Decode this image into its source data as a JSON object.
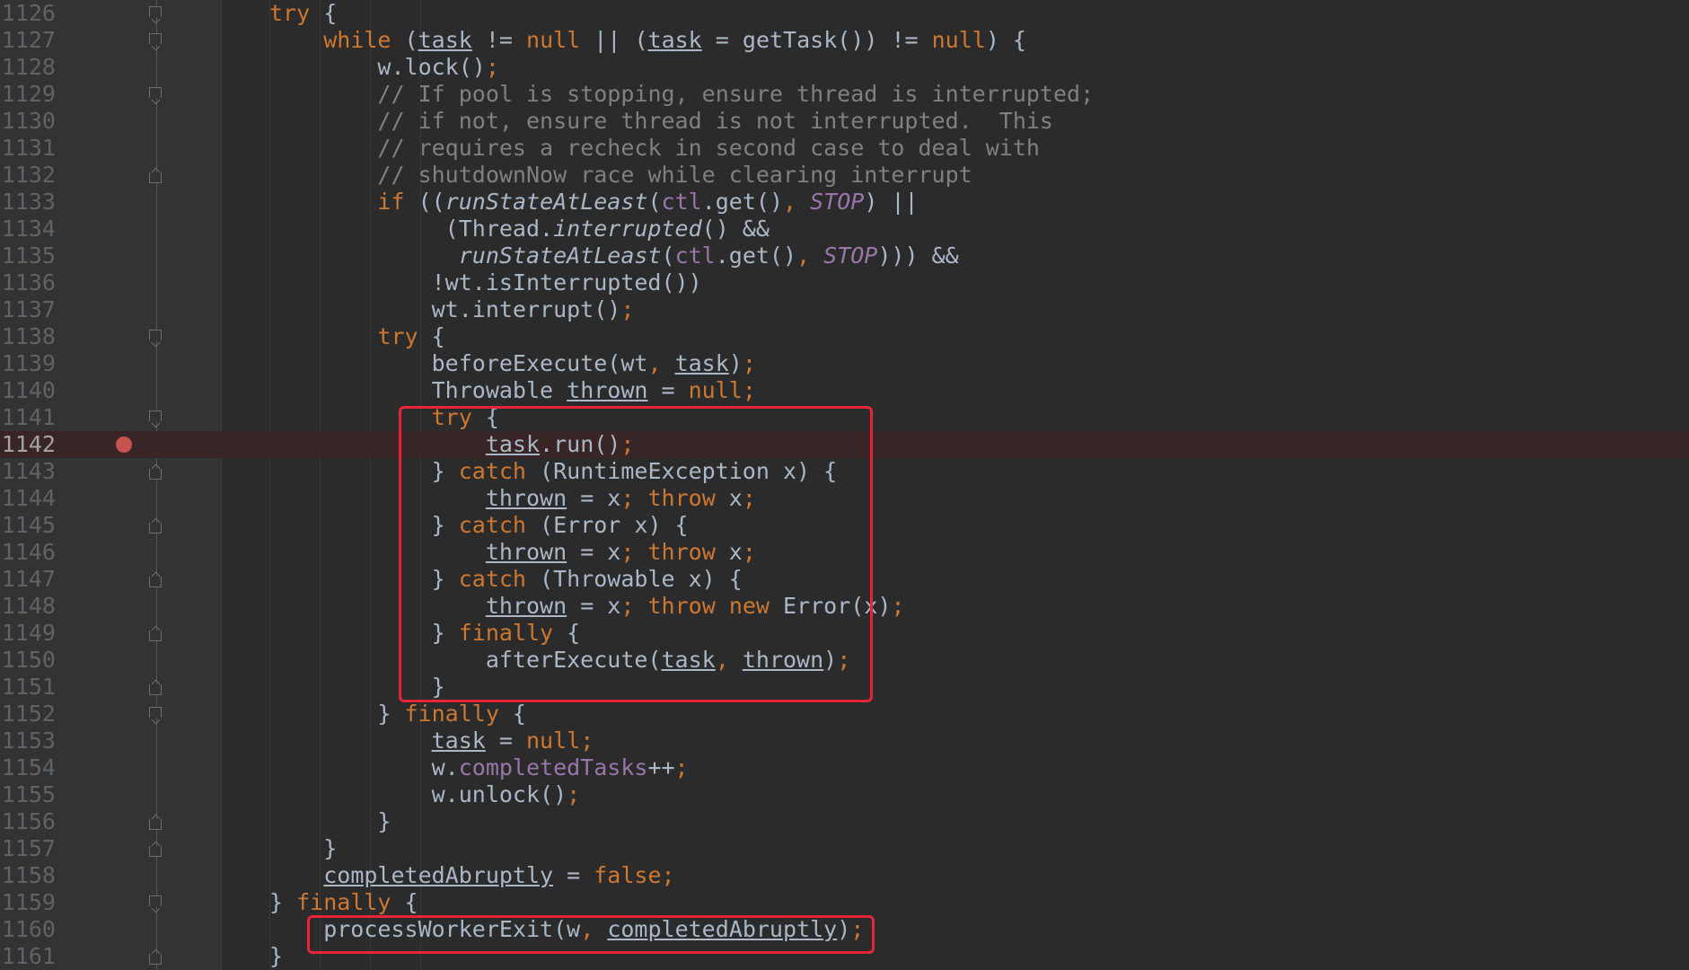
{
  "editor": {
    "lines": [
      {
        "number": "1126",
        "code": "try {",
        "indent": 0
      },
      {
        "number": "1127",
        "code": "    while (task != null || (task = getTask()) != null) {",
        "indent": 0
      },
      {
        "number": "1128",
        "code": "        w.lock();",
        "indent": 0
      },
      {
        "number": "1129",
        "code": "        // If pool is stopping, ensure thread is interrupted;",
        "indent": 0
      },
      {
        "number": "1130",
        "code": "        // if not, ensure thread is not interrupted.  This",
        "indent": 0
      },
      {
        "number": "1131",
        "code": "        // requires a recheck in second case to deal with",
        "indent": 0
      },
      {
        "number": "1132",
        "code": "        // shutdownNow race while clearing interrupt",
        "indent": 0
      },
      {
        "number": "1133",
        "code": "        if ((runStateAtLeast(ctl.get(), STOP) ||",
        "indent": 0
      },
      {
        "number": "1134",
        "code": "             (Thread.interrupted() &&",
        "indent": 0
      },
      {
        "number": "1135",
        "code": "              runStateAtLeast(ctl.get(), STOP))) &&",
        "indent": 0
      },
      {
        "number": "1136",
        "code": "            !wt.isInterrupted())",
        "indent": 0
      },
      {
        "number": "1137",
        "code": "            wt.interrupt();",
        "indent": 0
      },
      {
        "number": "1138",
        "code": "        try {",
        "indent": 0
      },
      {
        "number": "1139",
        "code": "            beforeExecute(wt, task);",
        "indent": 0
      },
      {
        "number": "1140",
        "code": "            Throwable thrown = null;",
        "indent": 0
      },
      {
        "number": "1141",
        "code": "            try {",
        "indent": 0
      },
      {
        "number": "1142",
        "code": "                task.run();",
        "indent": 0
      },
      {
        "number": "1143",
        "code": "            } catch (RuntimeException x) {",
        "indent": 0
      },
      {
        "number": "1144",
        "code": "                thrown = x; throw x;",
        "indent": 0
      },
      {
        "number": "1145",
        "code": "            } catch (Error x) {",
        "indent": 0
      },
      {
        "number": "1146",
        "code": "                thrown = x; throw x;",
        "indent": 0
      },
      {
        "number": "1147",
        "code": "            } catch (Throwable x) {",
        "indent": 0
      },
      {
        "number": "1148",
        "code": "                thrown = x; throw new Error(x);",
        "indent": 0
      },
      {
        "number": "1149",
        "code": "            } finally {",
        "indent": 0
      },
      {
        "number": "1150",
        "code": "                afterExecute(task, thrown);",
        "indent": 0
      },
      {
        "number": "1151",
        "code": "            }",
        "indent": 0
      },
      {
        "number": "1152",
        "code": "        } finally {",
        "indent": 0
      },
      {
        "number": "1153",
        "code": "            task = null;",
        "indent": 0
      },
      {
        "number": "1154",
        "code": "            w.completedTasks++;",
        "indent": 0
      },
      {
        "number": "1155",
        "code": "            w.unlock();",
        "indent": 0
      },
      {
        "number": "1156",
        "code": "        }",
        "indent": 0
      },
      {
        "number": "1157",
        "code": "    }",
        "indent": 0
      },
      {
        "number": "1158",
        "code": "    completedAbruptly = false;",
        "indent": 0
      },
      {
        "number": "1159",
        "code": "} finally {",
        "indent": 0
      },
      {
        "number": "1160",
        "code": "    processWorkerExit(w, completedAbruptly);",
        "indent": 0
      },
      {
        "number": "1161",
        "code": "}",
        "indent": 0
      }
    ],
    "current_line": "1142",
    "breakpoint_line": "1142",
    "colors": {
      "keyword": "#cc7832",
      "comment": "#808080",
      "field": "#9876aa",
      "plain": "#a9b7c6",
      "highlight_box": "#e8243b",
      "breakpoint": "#c75450"
    }
  }
}
